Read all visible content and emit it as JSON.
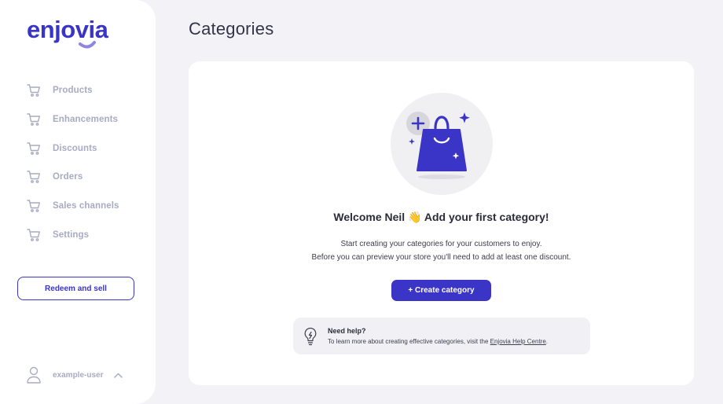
{
  "brand": {
    "name": "enjovia",
    "color": "#3a35c7"
  },
  "sidebar": {
    "items": [
      {
        "label": "Products",
        "icon": "cart-icon"
      },
      {
        "label": "Enhancements",
        "icon": "cart-icon"
      },
      {
        "label": "Discounts",
        "icon": "cart-icon"
      },
      {
        "label": "Orders",
        "icon": "cart-icon"
      },
      {
        "label": "Sales channels",
        "icon": "cart-icon"
      },
      {
        "label": "Settings",
        "icon": "cart-icon"
      }
    ],
    "redeem_label": "Redeem and sell",
    "user": {
      "name": "example-user",
      "icon": "user-icon",
      "toggle_icon": "chevron-up-icon"
    }
  },
  "main": {
    "title": "Categories",
    "empty_state": {
      "illustration_icon": "shopping-bag-icon",
      "welcome": "Welcome Neil 👋 Add your first category!",
      "line1": "Start creating your categories for your customers to enjoy.",
      "line2": "Before you can preview your store you'll need to add at least one discount.",
      "create_label": "+ Create category",
      "help": {
        "icon": "lightbulb-icon",
        "title": "Need help?",
        "text": "To learn more about creating effective categories, visit the",
        "link": "Enjovia Help Centre",
        "suffix": "."
      }
    }
  }
}
